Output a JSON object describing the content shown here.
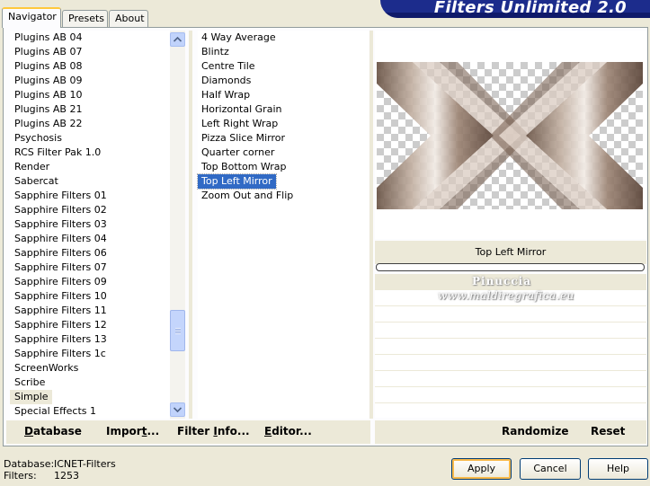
{
  "tabs": [
    {
      "label": "Navigator"
    },
    {
      "label": "Presets"
    },
    {
      "label": "About"
    }
  ],
  "banner": {
    "title": "Filters Unlimited 2.0"
  },
  "categories": [
    "Plugins AB 04",
    "Plugins AB 07",
    "Plugins AB 08",
    "Plugins AB 09",
    "Plugins AB 10",
    "Plugins AB 21",
    "Plugins AB 22",
    "Psychosis",
    "RCS Filter Pak 1.0",
    "Render",
    "Sabercat",
    "Sapphire Filters 01",
    "Sapphire Filters 02",
    "Sapphire Filters 03",
    "Sapphire Filters 04",
    "Sapphire Filters 06",
    "Sapphire Filters 07",
    "Sapphire Filters 09",
    "Sapphire Filters 10",
    "Sapphire Filters 11",
    "Sapphire Filters 12",
    "Sapphire Filters 13",
    "Sapphire Filters 1c",
    "ScreenWorks",
    "Scribe",
    "Simple",
    "Special Effects 1"
  ],
  "selected_category": "Simple",
  "filters": [
    "4 Way Average",
    "Blintz",
    "Centre Tile",
    "Diamonds",
    "Half Wrap",
    "Horizontal Grain",
    "Left Right Wrap",
    "Pizza Slice Mirror",
    "Quarter corner",
    "Top Bottom Wrap",
    "Top Left Mirror",
    "Zoom Out and Flip"
  ],
  "selected_filter": "Top Left Mirror",
  "preview": {
    "label": "Top Left Mirror"
  },
  "watermark": {
    "line1": "Pinuccia",
    "line2": "www.maldiregrafica.eu"
  },
  "left_buttons": {
    "database": "Database",
    "import": "Import...",
    "filter_info": "Filter Info...",
    "editor": "Editor..."
  },
  "right_buttons": {
    "randomize": "Randomize",
    "reset": "Reset"
  },
  "status": {
    "database_label": "Database:",
    "database_value": "ICNET-Filters",
    "filters_label": "Filters:",
    "filters_value": "1253"
  },
  "dialog_buttons": {
    "apply": "Apply",
    "cancel": "Cancel",
    "help": "Help"
  },
  "colors": {
    "selection": "#316ac5",
    "banner": "#1c2c8c",
    "background": "#ece9d8"
  }
}
